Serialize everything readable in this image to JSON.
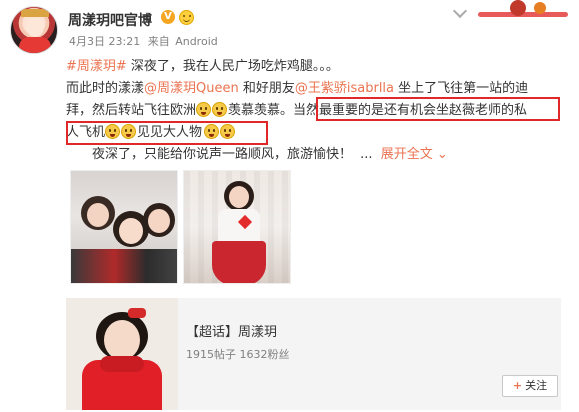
{
  "header": {
    "username": "周漾玥吧官博",
    "verified_badge": "V",
    "verified_color": "#f5a623",
    "time": "4月3日 23:21",
    "source_prefix": "来自",
    "source": "Android",
    "options_icon": "chevron-down-icon"
  },
  "post": {
    "hashtag": "#周漾玥#",
    "line1_rest": " 深夜了，我在人民广场吃炸鸡腿。。。",
    "line2_a": "而此时的漾漾",
    "mention1": "@周漾玥Queen",
    "line2_b": " 和好朋友",
    "mention2": "@王紫骄isabrlla",
    "line2_c": " 坐上了飞往第一站的迪",
    "line3_a": "拜，然后转站飞往欧洲",
    "line3_b": "羡慕羡慕。",
    "line3_c": "当然最重要的是还有机会坐赵薇老师的私",
    "line4_a": "人飞机",
    "line4_b": "见见大人物",
    "line5": "夜深了，只能给你说声一路顺风，旅游愉快！",
    "line5_ellipsis": "...",
    "expand_label": "展开全文",
    "expand_arrow": "⌄",
    "link_color": "#eb7350",
    "highlight_color": "#e02828"
  },
  "card": {
    "title": "【超话】周漾玥",
    "stats": "1915帖子 1632粉丝",
    "follow_plus": "+",
    "follow_label": "关注"
  }
}
